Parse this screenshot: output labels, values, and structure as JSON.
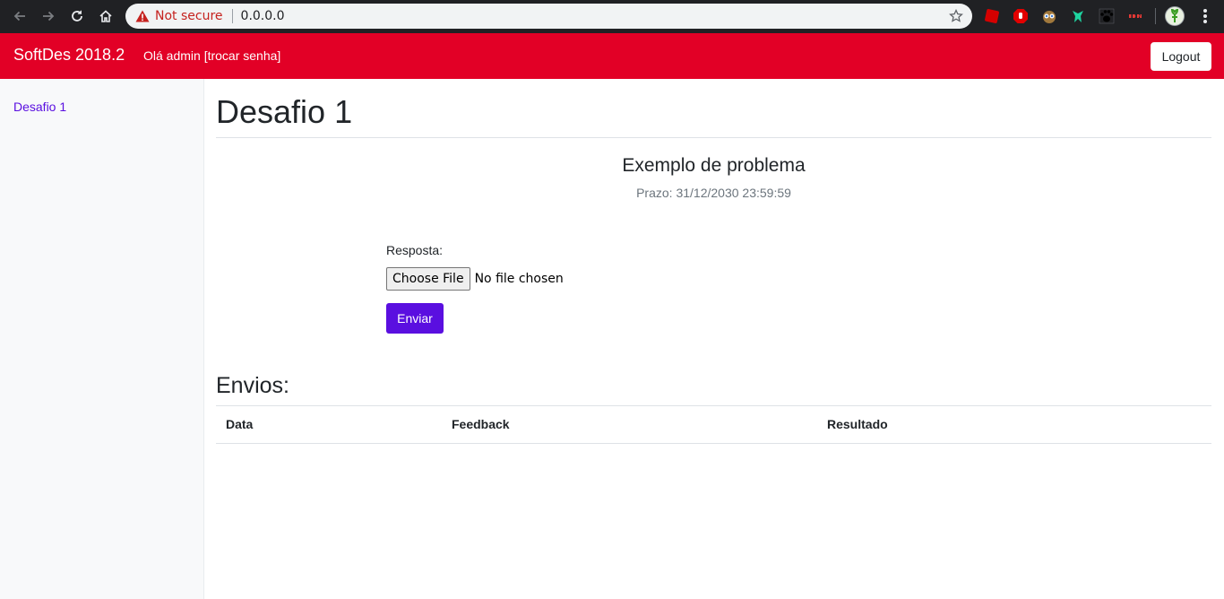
{
  "browser": {
    "security_label": "Not secure",
    "url": "0.0.0.0",
    "icons": [
      "back-icon",
      "forward-icon",
      "reload-icon",
      "home-icon",
      "warning-icon",
      "bookmark-star-icon",
      "menu-icon"
    ],
    "extensions": [
      "extension-red-icon",
      "adblock-icon",
      "owl-icon",
      "bird-icon",
      "paw-icon",
      "vpn-icon"
    ]
  },
  "navbar": {
    "brand": "SoftDes 2018.2",
    "greeting": "Olá admin [trocar senha]",
    "logout_label": "Logout",
    "color": "#e20026"
  },
  "sidebar": {
    "items": [
      {
        "label": "Desafio 1"
      }
    ]
  },
  "main": {
    "title": "Desafio 1",
    "problem_title": "Exemplo de problema",
    "deadline": "Prazo: 31/12/2030 23:59:59",
    "form": {
      "answer_label": "Resposta:",
      "choose_file_label": "Choose File",
      "no_file_text": "No file chosen",
      "submit_label": "Enviar",
      "submit_color": "#5a0fe0"
    },
    "submissions": {
      "title": "Envios:",
      "columns": [
        "Data",
        "Feedback",
        "Resultado"
      ],
      "rows": []
    }
  }
}
